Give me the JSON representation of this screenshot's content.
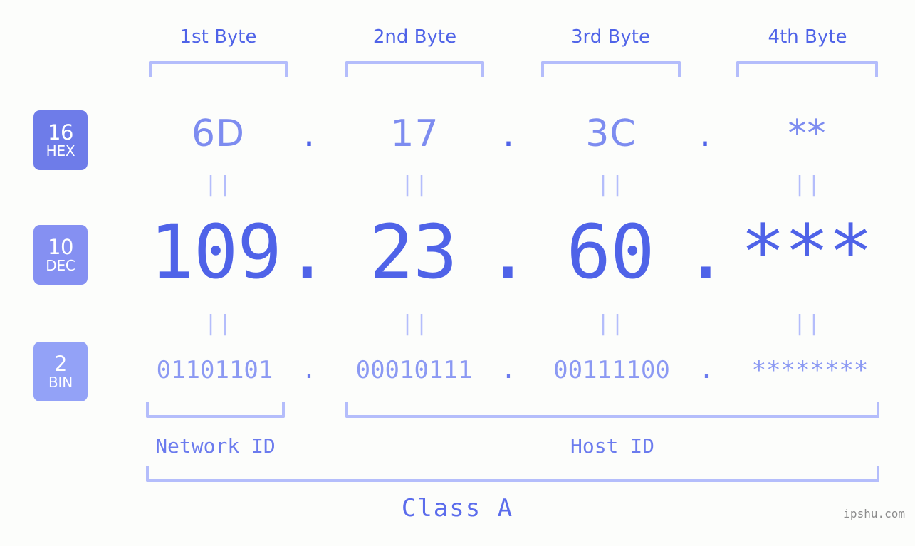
{
  "background_color": "#fcfdfb",
  "accent_color": "#4f63e8",
  "accent_light_color": "#b4bdfb",
  "byte_headers": [
    {
      "label": "1st Byte"
    },
    {
      "label": "2nd Byte"
    },
    {
      "label": "3rd Byte"
    },
    {
      "label": "4th Byte"
    }
  ],
  "bases": [
    {
      "number": "16",
      "name": "HEX",
      "color": "#6e7ce9"
    },
    {
      "number": "10",
      "name": "DEC",
      "color": "#8590f2"
    },
    {
      "number": "2",
      "name": "BIN",
      "color": "#93a2f7"
    }
  ],
  "rows": {
    "hex": {
      "values": [
        "6D",
        "17",
        "3C",
        "**"
      ],
      "separator": "."
    },
    "dec": {
      "values": [
        "109",
        "23",
        "60",
        "***"
      ],
      "separator": "."
    },
    "bin": {
      "values": [
        "01101101",
        "00010111",
        "00111100",
        "********"
      ],
      "separator": "."
    }
  },
  "equals_marks": {
    "symbol": "||",
    "rows": 2,
    "count_per_row": 4
  },
  "segments": [
    {
      "label": "Network ID"
    },
    {
      "label": "Host ID"
    }
  ],
  "class": {
    "label": "Class A"
  },
  "watermark": {
    "text": "ipshu.com"
  }
}
